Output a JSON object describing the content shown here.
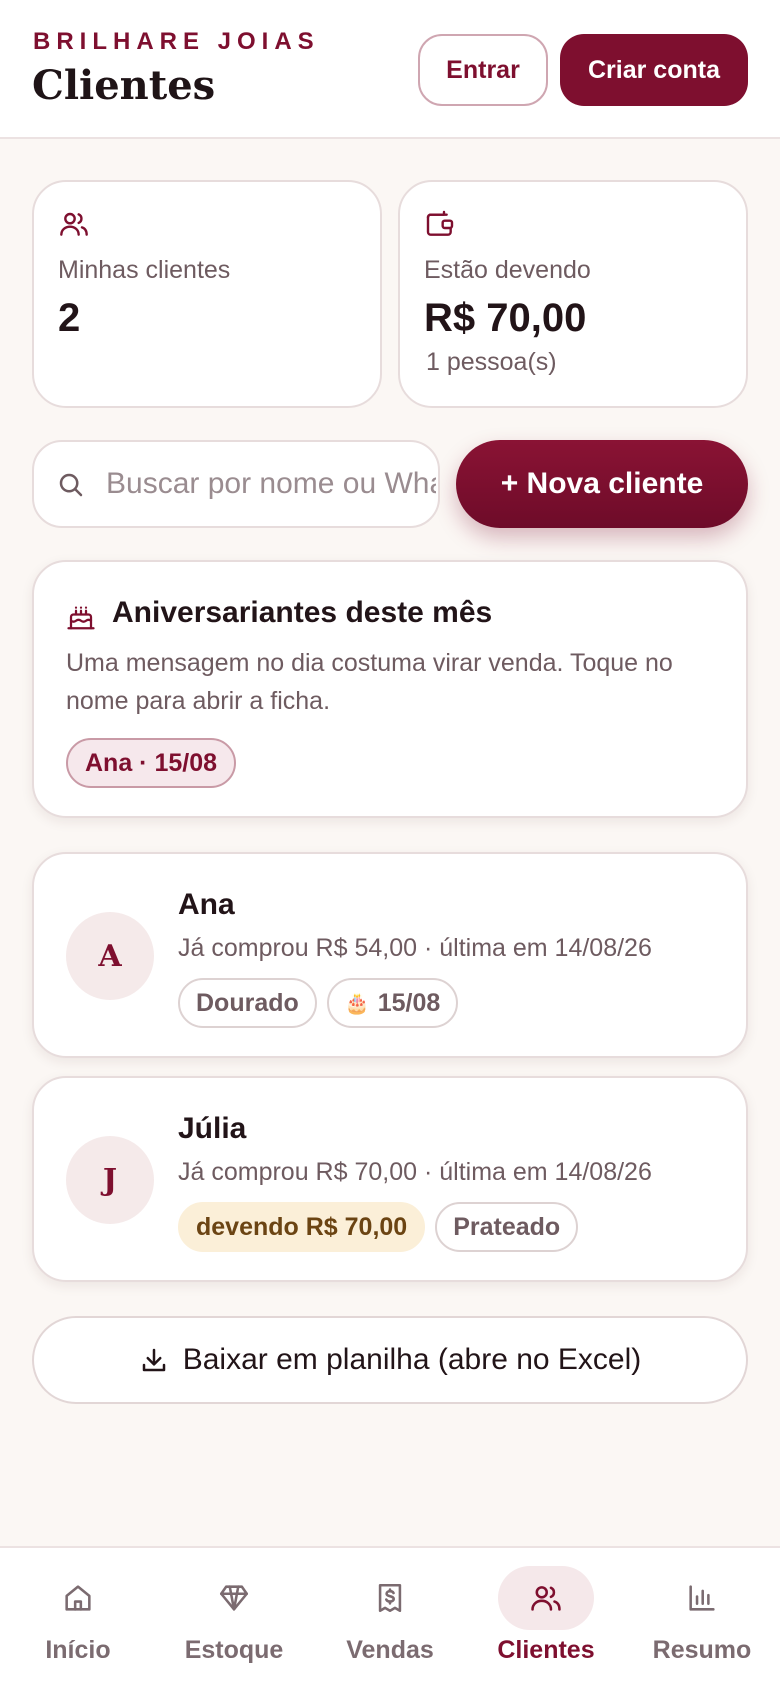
{
  "header": {
    "brand": "BRILHARE JOIAS",
    "title": "Clientes",
    "login_label": "Entrar",
    "signup_label": "Criar conta"
  },
  "stats": {
    "clients": {
      "icon": "users-icon",
      "label": "Minhas clientes",
      "value": "2"
    },
    "owing": {
      "icon": "wallet-icon",
      "label": "Estão devendo",
      "value": "R$ 70,00",
      "sub": "1 pessoa(s)"
    }
  },
  "search": {
    "placeholder": "Buscar por nome ou WhatsApp",
    "value": ""
  },
  "new_client_label": "+ Nova cliente",
  "birthdays": {
    "icon": "cake-icon",
    "title": "Aniversariantes deste mês",
    "text": "Uma mensagem no dia costuma virar venda. Toque no nome para abrir a ficha.",
    "chip": "Ana · 15/08"
  },
  "clients": [
    {
      "initial": "A",
      "name": "Ana",
      "summary": "Já comprou R$ 54,00 · última em 14/08/26",
      "chips": {
        "tier": "Dourado",
        "birthday": "15/08"
      }
    },
    {
      "initial": "J",
      "name": "Júlia",
      "summary": "Já comprou R$ 70,00 · última em 14/08/26",
      "chips": {
        "debt": "devendo R$ 70,00",
        "tier": "Prateado"
      }
    }
  ],
  "export_label": "Baixar em planilha (abre no Excel)",
  "nav": [
    {
      "label": "Início",
      "icon": "home-icon",
      "active": false
    },
    {
      "label": "Estoque",
      "icon": "diamond-icon",
      "active": false
    },
    {
      "label": "Vendas",
      "icon": "receipt-icon",
      "active": false
    },
    {
      "label": "Clientes",
      "icon": "users-icon",
      "active": true
    },
    {
      "label": "Resumo",
      "icon": "bar-chart-icon",
      "active": false
    }
  ],
  "colors": {
    "brand": "#7e0f2f",
    "background": "#fbf7f4",
    "debt_chip": "#fbefd8",
    "active_nav": "#f5e8ea"
  }
}
